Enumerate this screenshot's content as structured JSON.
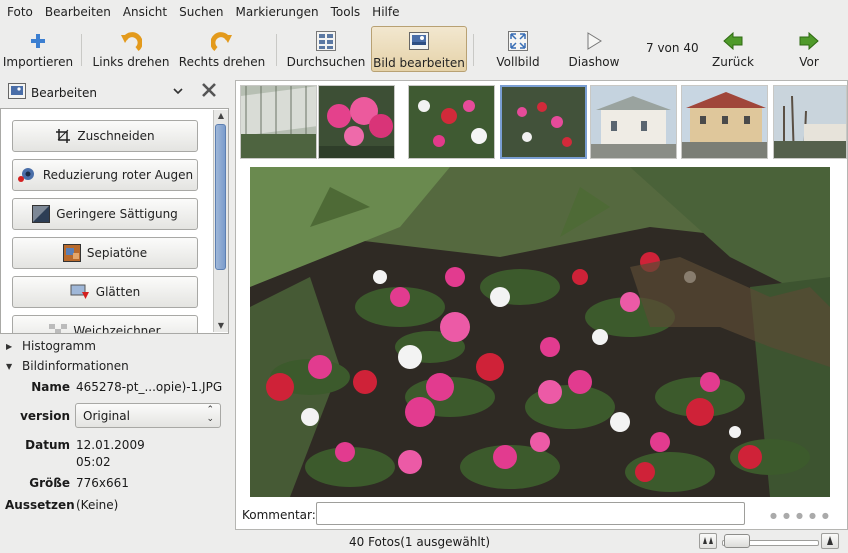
{
  "menu": [
    "Foto",
    "Bearbeiten",
    "Ansicht",
    "Suchen",
    "Markierungen",
    "Tools",
    "Hilfe"
  ],
  "toolbar": {
    "import_label": "Importieren",
    "rotate_left_label": "Links drehen",
    "rotate_right_label": "Rechts drehen",
    "browse_label": "Durchsuchen",
    "edit_label": "Bild bearbeiten",
    "fullscreen_label": "Vollbild",
    "slideshow_label": "Diashow",
    "counter": "7 von 40",
    "back_label": "Zurück",
    "forward_label": "Vor"
  },
  "panel": {
    "title": "Bearbeiten",
    "tools": [
      "Zuschneiden",
      "Reduzierung roter Augen",
      "Geringere Sättigung",
      "Sepiatöne",
      "Glätten",
      "Weichzeichner"
    ],
    "histogram_label": "Histogramm",
    "info_label": "Bildinformationen",
    "info": {
      "name_label": "Name",
      "name_value": "465278-pt_...opie)-1.JPG",
      "version_label": "version",
      "version_value": "Original",
      "date_label": "Datum",
      "date_value": "12.01.2009",
      "time_value": "05:02",
      "size_label": "Größe",
      "size_value": "776x661",
      "exposure_label": "Aussetzen",
      "exposure_value": "(Keine)"
    }
  },
  "comment_label": "Kommentar:",
  "status": {
    "text": "40 Fotos(1 ausgewählt)"
  },
  "colors": {
    "accent": "#7a9ed2",
    "active_button": "#e5d2a8",
    "arrow_green": "#4f9a2a"
  }
}
